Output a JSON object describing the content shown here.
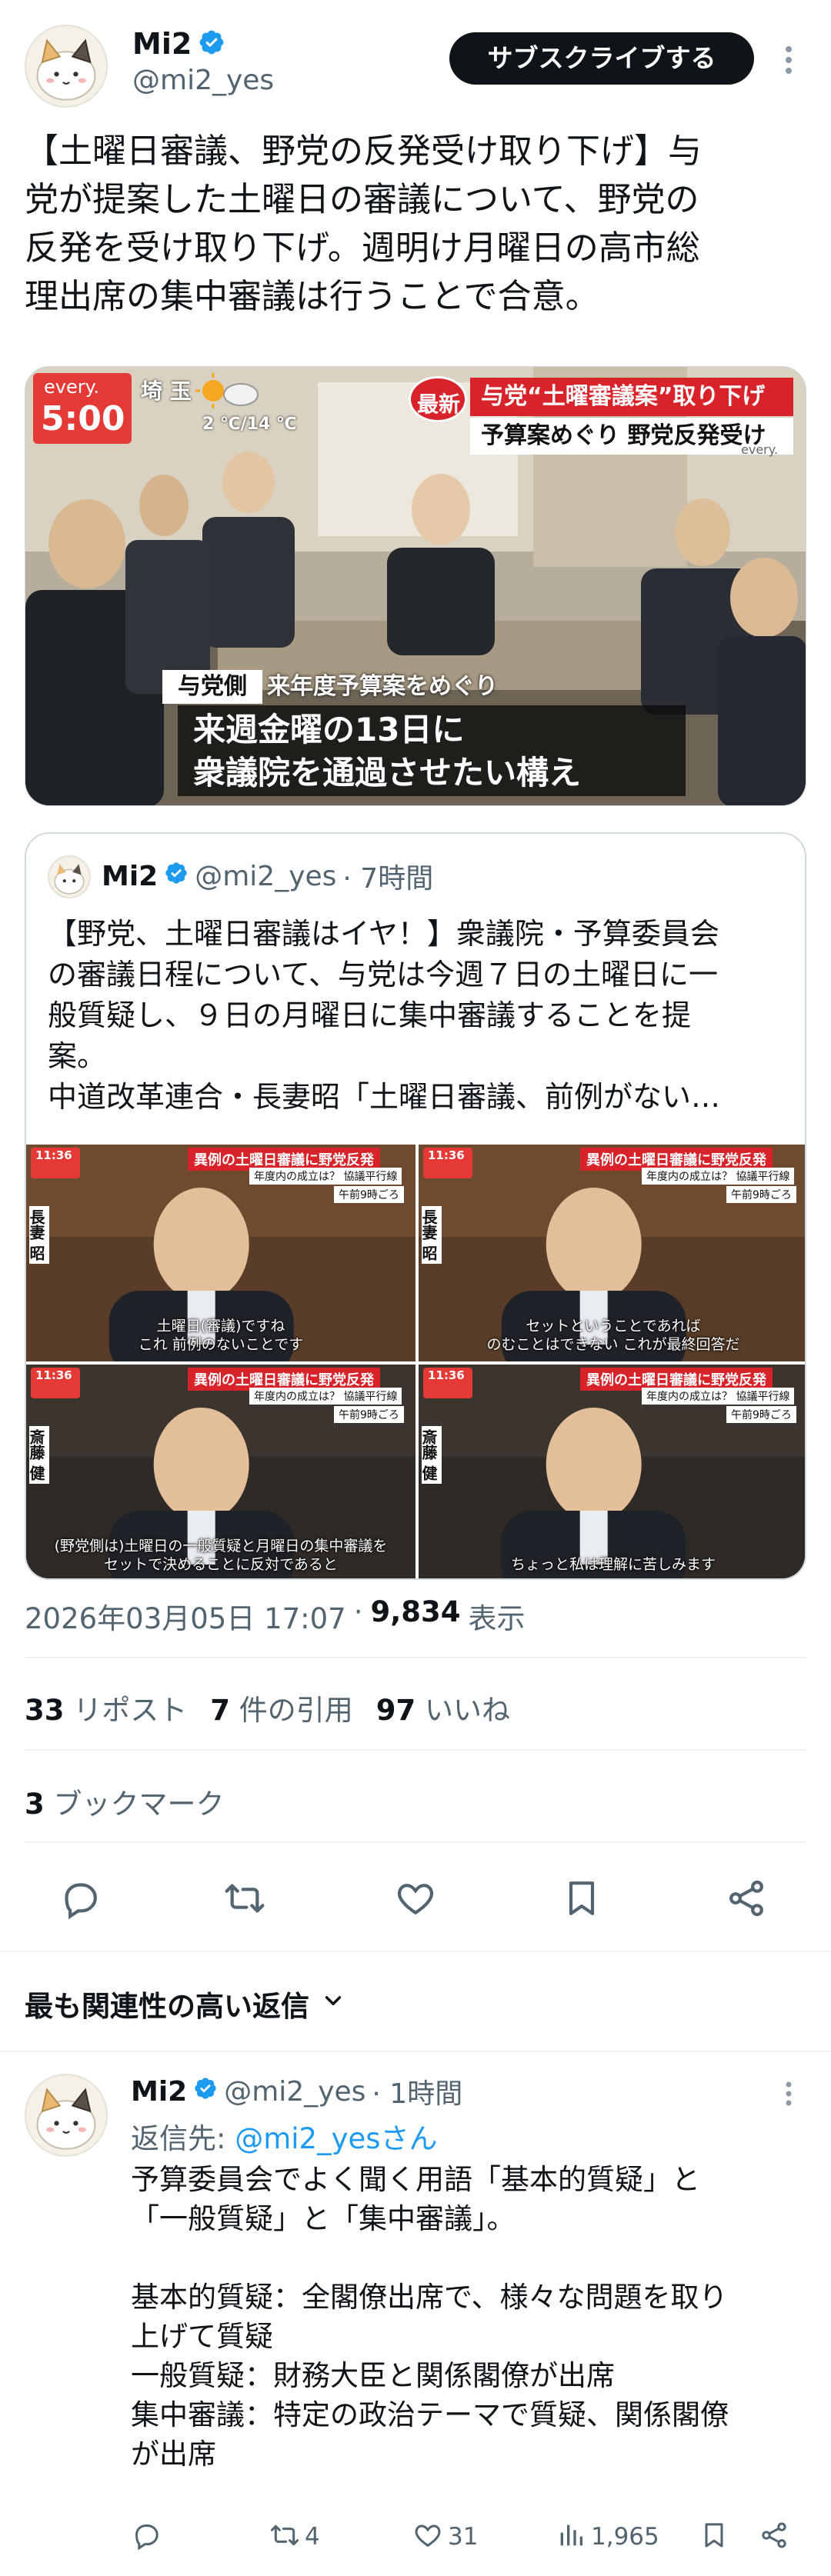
{
  "author": {
    "name": "Mi2",
    "handle": "@mi2_yes"
  },
  "header": {
    "subscribe_label": "サブスクライブする"
  },
  "tweet": {
    "text": "【土曜日審議、野党の反発受け取り下げ】与\n党が提案した土曜日の審議について、野党の\n反発を受け取り下げ。週明け月曜日の高市総\n理出席の集中審議は行うことで合意。"
  },
  "media": {
    "channel_logo": "every.",
    "time": "5:00",
    "weather_location": "埼 玉",
    "weather_temp": "2 ℃/14 ℃",
    "breaking_badge": "最新",
    "headline_1": "与党“土曜審議案”取り下げ",
    "headline_2": "予算案めぐり 野党反発受け",
    "headline_small": "every.",
    "caption_tag": "与党側",
    "caption_sub": "来年度予算案をめぐり",
    "caption_line1": "来週金曜の13日に",
    "caption_line2": "衆議院を通過させたい構え"
  },
  "quote": {
    "name": "Mi2",
    "handle": "@mi2_yes",
    "time": "· 7時間",
    "text": "【野党、土曜日審議はイヤ！】衆議院・予算委員会\nの審議日程について、与党は今週７日の土曜日に一\n般質疑し、９日の月曜日に集中審議することを提\n案。\n中道改革連合・長妻昭「土曜日審議、前例がない…",
    "frames": [
      {
        "time": "11:36",
        "banner": "異例の土曜日審議に野党反発",
        "sub": "年度内の成立は？ 協議平行線",
        "clock": "午前9時ごろ",
        "name": "長妻 昭",
        "subtitle": "土曜日(審議)ですね\nこれ 前例のないことです"
      },
      {
        "time": "11:36",
        "banner": "異例の土曜日審議に野党反発",
        "sub": "年度内の成立は？ 協議平行線",
        "clock": "午前9時ごろ",
        "name": "長妻 昭",
        "subtitle": "セットということであれば\nのむことはできない これが最終回答だ"
      },
      {
        "time": "11:36",
        "banner": "異例の土曜日審議に野党反発",
        "sub": "年度内の成立は？ 協議平行線",
        "clock": "午前9時ごろ",
        "name": "斎藤 健",
        "subtitle": "(野党側は)土曜日の一般質疑と月曜日の集中審議を\nセットで決めることに反対であると"
      },
      {
        "time": "11:36",
        "banner": "異例の土曜日審議に野党反発",
        "sub": "年度内の成立は？ 協議平行線",
        "clock": "午前9時ごろ",
        "name": "斎藤 健",
        "subtitle": "ちょっと私は理解に苦しみます"
      }
    ]
  },
  "meta": {
    "timestamp": "2026年03月05日 17:07",
    "separator": "·",
    "views": "9,834",
    "views_label": "表示"
  },
  "stats": {
    "reposts": "33",
    "reposts_label": "リポスト",
    "quotes": "7",
    "quotes_label": "件の引用",
    "likes": "97",
    "likes_label": "いいね",
    "bookmarks": "3",
    "bookmarks_label": "ブックマーク"
  },
  "replies_section": {
    "sort_label": "最も関連性の高い返信"
  },
  "reply": {
    "name": "Mi2",
    "handle": "@mi2_yes",
    "time": "· 1時間",
    "reply_to_prefix": "返信先: ",
    "reply_to_handle": "@mi2_yesさん",
    "text": "予算委員会でよく聞く用語「基本的質疑」と\n「一般質疑」と「集中審議」。\n\n基本的質疑：全閣僚出席で、様々な問題を取り\n上げて質疑\n一般質疑：財務大臣と関係閣僚が出席\n集中審議：特定の政治テーマで質疑、関係閣僚\nが出席",
    "reposts": "4",
    "likes": "31",
    "views": "1,965"
  },
  "colors": {
    "accent": "#1d9bf0",
    "muted": "#536471",
    "divider": "#eff3f4",
    "headline_red": "#d8232a"
  },
  "icons": [
    "verified-badge-icon",
    "more-dots-icon",
    "reply-icon",
    "repost-icon",
    "like-icon",
    "bookmark-icon",
    "share-icon",
    "views-icon",
    "chevron-down-icon",
    "sunny-cloudy-icon"
  ]
}
